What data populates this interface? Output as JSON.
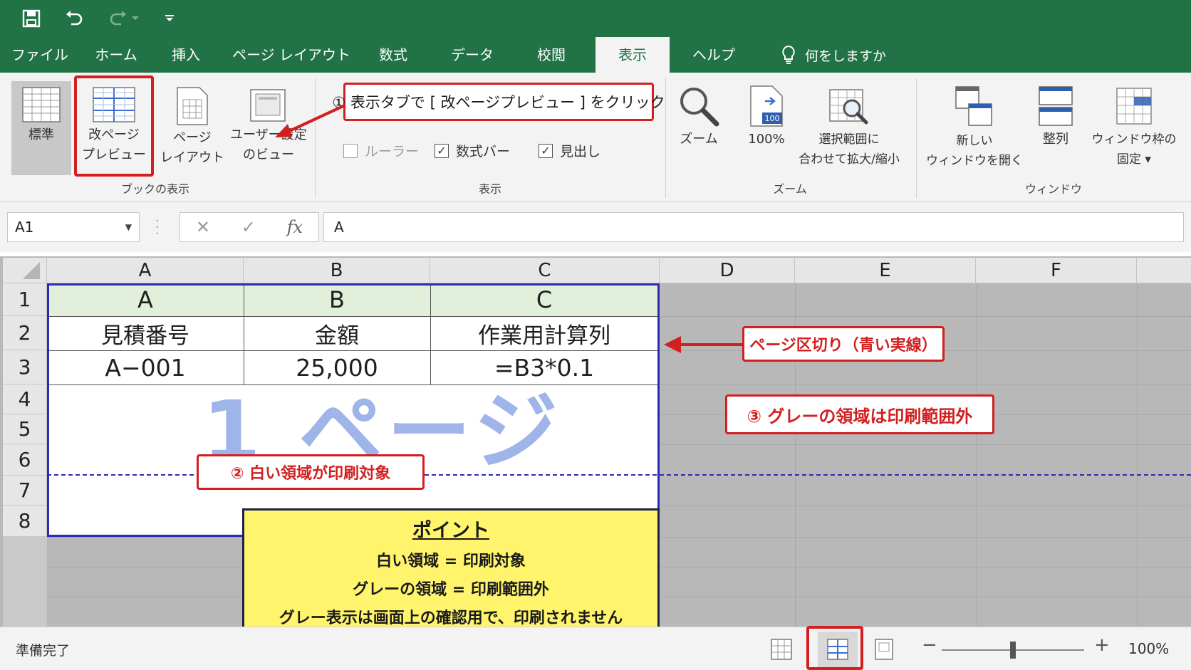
{
  "menu_tabs": [
    "ファイル",
    "ホーム",
    "挿入",
    "ページ レイアウト",
    "数式",
    "データ",
    "校閲",
    "表示",
    "ヘルプ"
  ],
  "active_tab": "表示",
  "tell_me": "何をしますか",
  "ribbon": {
    "views": {
      "normal": "標準",
      "page_break_preview": "改ページ\nプレビュー",
      "page_layout": "ページ\nレイアウト",
      "custom_views": "ユーザー設定\nのビュー",
      "group_label": "ブックの表示"
    },
    "show": {
      "ruler": "ルーラー",
      "formula_bar": "数式バー",
      "headings": "見出し",
      "ruler_checked": false,
      "formula_bar_checked": true,
      "headings_checked": true,
      "group_label": "表示"
    },
    "zoom": {
      "zoom": "ズーム",
      "hundred": "100%",
      "hundred_icon_text": "100",
      "zoom_to_selection": "選択範囲に\n合わせて拡大/縮小",
      "group_label": "ズーム"
    },
    "window": {
      "new_window": "新しい\nウィンドウを開く",
      "arrange": "整列",
      "freeze_panes": "ウィンドウ枠の\n固定 ▾",
      "group_label": "ウィンドウ"
    }
  },
  "formula_bar": {
    "name_box": "A1",
    "formula": "A",
    "fx": "fx",
    "cancel": "✕",
    "enter": "✓"
  },
  "columns": [
    "A",
    "B",
    "C",
    "D",
    "E",
    "F"
  ],
  "rows": [
    "1",
    "2",
    "3",
    "4",
    "5",
    "6",
    "7",
    "8"
  ],
  "cells": {
    "r1": [
      "A",
      "B",
      "C"
    ],
    "r2": [
      "見積番号",
      "金額",
      "作業用計算列"
    ],
    "r3": [
      "A−001",
      "25,000",
      "=B3*0.1"
    ]
  },
  "page_watermark": "1 ページ",
  "callouts": {
    "step1": "① 表示タブで [ 改ページプレビュー ] をクリック",
    "page_break": "ページ区切り（青い実線）",
    "step2": "② 白い領域が印刷対象",
    "step3": "③ グレーの領域は印刷範囲外"
  },
  "note": {
    "title": "ポイント",
    "lines": [
      "白い領域 = 印刷対象",
      "グレーの領域 = 印刷範囲外",
      "グレー表示は画面上の確認用で、印刷されません"
    ]
  },
  "status": {
    "ready": "準備完了",
    "zoom": "100%",
    "zoom_minus": "−",
    "zoom_plus": "+"
  },
  "colors": {
    "excel_green": "#217346",
    "callout_red": "#d21f1f",
    "page_border_blue": "#2b2bb4",
    "header_row_fill": "#e2efda",
    "note_yellow": "#fff46c"
  }
}
